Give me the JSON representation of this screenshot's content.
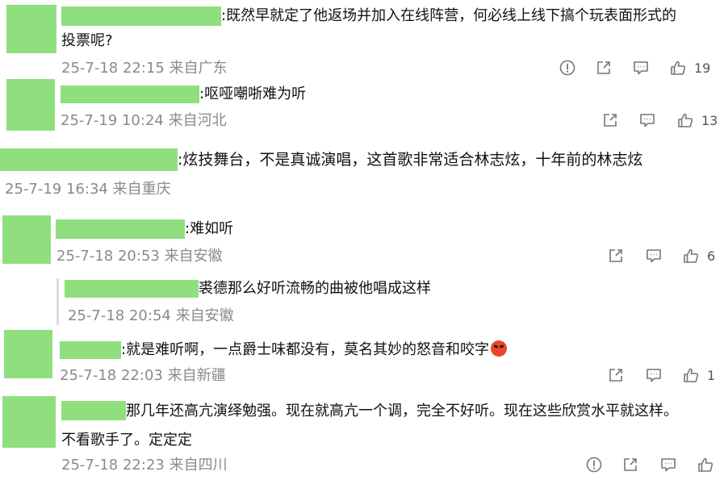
{
  "comments": [
    {
      "text_line1": ":既然早就定了他返场并加入在线阵营，何必线上线下搞个玩表面形式的",
      "text_line2": "投票呢?",
      "meta": "25-7-18 22:15 来自广东",
      "likes": "19"
    },
    {
      "text": ":呕哑嘲哳难为听",
      "meta": "25-7-19 10:24 来自河北",
      "likes": "13"
    },
    {
      "text": ":炫技舞台，不是真诚演唱，这首歌非常适合林志炫，十年前的林志炫",
      "meta": "25-7-19 16:34 来自重庆"
    },
    {
      "text": ":难如听",
      "meta": "25-7-18 20:53 来自安徽",
      "likes": "6",
      "reply": {
        "text": "裘德那么好听流畅的曲被他唱成这样",
        "meta": "25-7-18 20:54 来自安徽"
      }
    },
    {
      "text": ":就是难听啊，一点爵士味都没有，莫名其妙的怒音和咬字",
      "emoji": "angry-face",
      "meta": "25-7-18 22:03 来自新疆",
      "likes": "1"
    },
    {
      "text_line1": "那几年还高亢演绎勉强。现在就高亢一个调，完全不好听。现在这些欣赏水平就这样。",
      "text_line2": "不看歌手了。定定定",
      "meta": "25-7-18 22:23 来自四川"
    }
  ],
  "icons": {
    "report": "report-icon",
    "share": "share-icon",
    "comment": "comment-icon",
    "like": "like-icon"
  },
  "colors": {
    "redaction": "#8fdf7f",
    "meta_text": "#8a8a8a",
    "icon_stroke": "#777777"
  }
}
